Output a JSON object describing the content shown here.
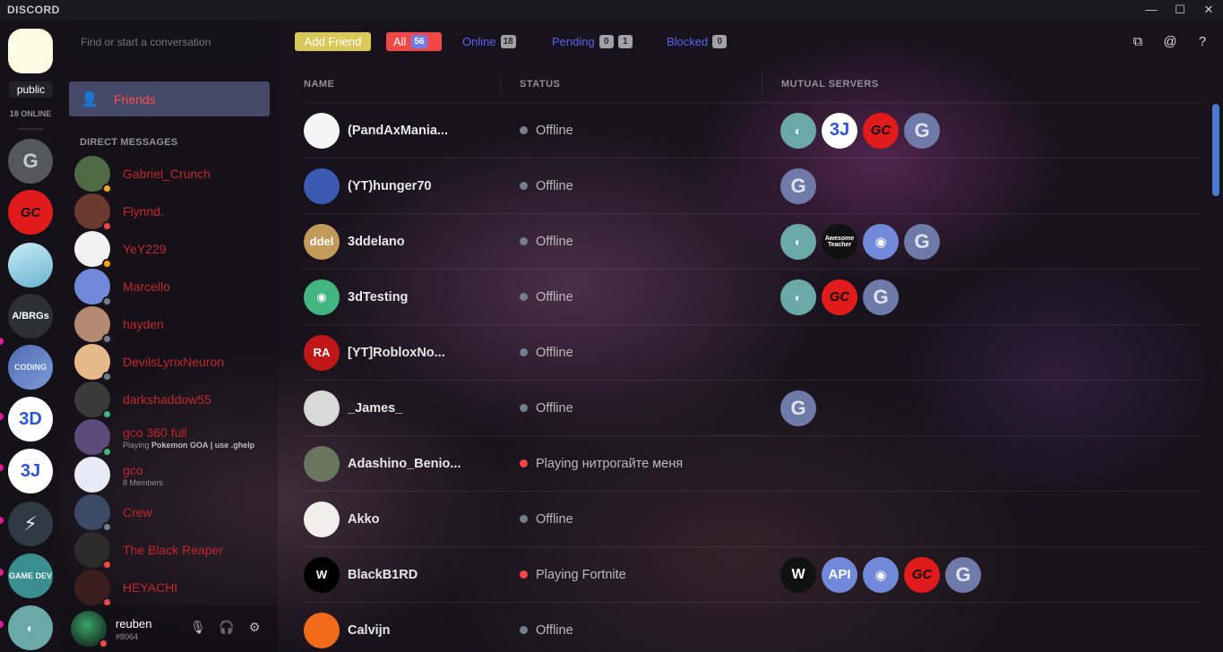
{
  "app": {
    "title": "DISCORD",
    "window_controls": [
      "—",
      "☐",
      "✕"
    ]
  },
  "guilds": {
    "current": {
      "label": "public",
      "color": "#fffbe3"
    },
    "online_count": "18 ONLINE",
    "items": [
      {
        "name": "guild-g",
        "icon": "G",
        "style": "grey"
      },
      {
        "name": "guild-gc-red",
        "icon": "GC",
        "style": "red"
      },
      {
        "name": "guild-ice",
        "icon": "",
        "style": "ice"
      },
      {
        "name": "guild-abrgs",
        "icon": "A/BRGs",
        "style": "dark"
      },
      {
        "name": "guild-coding",
        "icon": "CODING",
        "style": "code"
      },
      {
        "name": "guild-3d",
        "icon": "3D",
        "style": "white"
      },
      {
        "name": "guild-3j",
        "icon": "3J",
        "style": "white"
      },
      {
        "name": "guild-bolt",
        "icon": "⚡",
        "style": "bolt"
      },
      {
        "name": "guild-game-dev",
        "icon": "GAME DEV",
        "style": "game"
      },
      {
        "name": "guild-parrot",
        "icon": "◐",
        "style": "teal"
      }
    ]
  },
  "sidebar": {
    "search_placeholder": "Find or start a conversation",
    "friends_label": "Friends",
    "dm_header": "DIRECT MESSAGES",
    "dms": [
      {
        "name": "Gabriel_Crunch",
        "sub": "",
        "status": "#faa61a",
        "avatar": "#4d6a44"
      },
      {
        "name": "Flynnd.",
        "sub": "",
        "status": "#f04747",
        "avatar": "#6b3a2f"
      },
      {
        "name": "YeY229",
        "sub": "",
        "status": "#faa61a",
        "avatar": "#f1f1f1"
      },
      {
        "name": "Marcello",
        "sub": "",
        "status": "#747f8d",
        "avatar": "#7289da"
      },
      {
        "name": "hayden",
        "sub": "",
        "status": "#747f8d",
        "avatar": "#b48a72"
      },
      {
        "name": "DevilsLynxNeuron",
        "sub": "",
        "status": "#747f8d",
        "avatar": "#e6b98a"
      },
      {
        "name": "darkshaddow55",
        "sub": "",
        "status": "#43b581",
        "avatar": "#3a3a3a"
      },
      {
        "name": "gco 360 full",
        "sub_prefix": "Playing",
        "sub_bold": "Pokemon GOA | use .ghelp",
        "status": "#43b581",
        "avatar": "#5b4a7a"
      },
      {
        "name": "gco",
        "sub": "8 Members",
        "status": "",
        "avatar": "#e8eaf5"
      },
      {
        "name": "Crew",
        "sub": "",
        "status": "#747f8d",
        "avatar": "#3d4a66"
      },
      {
        "name": "The Black Reaper",
        "sub": "",
        "status": "#f04747",
        "avatar": "#2b2b2b"
      },
      {
        "name": "HEYACHI",
        "sub": "",
        "status": "#f04747",
        "avatar": "#3a1e1e"
      }
    ],
    "user": {
      "name": "reuben",
      "discriminator": "#8064"
    },
    "user_controls": [
      "🎙",
      "🎧",
      "⚙"
    ]
  },
  "toolbar": {
    "add_friend": "Add Friend",
    "all_label": "All",
    "all_count": "56",
    "online_label": "Online",
    "online_count": "18",
    "pending_label": "Pending",
    "pending_in": "0",
    "pending_out": "1",
    "blocked_label": "Blocked",
    "blocked_count": "0",
    "icons": [
      "new-group-icon",
      "mention-icon",
      "help-icon"
    ],
    "icon_glyphs": [
      "⧉",
      "@",
      "?"
    ]
  },
  "table": {
    "headers": [
      "NAME",
      "STATUS",
      "MUTUAL SERVERS"
    ],
    "rows": [
      {
        "name": "(PandAxMania...",
        "status": "Offline",
        "dot": "#747f8d",
        "avatar": "#f5f5f5",
        "initial": "",
        "mutual": [
          {
            "icon": "◐",
            "style": "teal"
          },
          {
            "icon": "3J",
            "style": "white"
          },
          {
            "icon": "GC",
            "style": "red"
          },
          {
            "icon": "G",
            "style": "greyc"
          }
        ]
      },
      {
        "name": "(YT)hunger70",
        "status": "Offline",
        "dot": "#747f8d",
        "avatar": "#3b5bb3",
        "initial": "",
        "mutual": [
          {
            "icon": "G",
            "style": "greyc"
          }
        ]
      },
      {
        "name": "3ddelano",
        "status": "Offline",
        "dot": "#747f8d",
        "avatar": "#c49a5b",
        "initial": "ddel",
        "mutual": [
          {
            "icon": "◐",
            "style": "teal"
          },
          {
            "icon": "Awesome Teacher",
            "style": "black"
          },
          {
            "icon": "◉",
            "style": "blurple"
          },
          {
            "icon": "G",
            "style": "greyc"
          }
        ]
      },
      {
        "name": "3dTesting",
        "status": "Offline",
        "dot": "#747f8d",
        "avatar": "#43b581",
        "initial": "◉",
        "mutual": [
          {
            "icon": "◐",
            "style": "teal"
          },
          {
            "icon": "GC",
            "style": "red"
          },
          {
            "icon": "G",
            "style": "greyc"
          }
        ]
      },
      {
        "name": "[YT]RobloxNo...",
        "status": "Offline",
        "dot": "#747f8d",
        "avatar": "#c01818",
        "initial": "RA",
        "mutual": []
      },
      {
        "name": "_James_",
        "status": "Offline",
        "dot": "#747f8d",
        "avatar": "#d8d8d8",
        "initial": "",
        "mutual": [
          {
            "icon": "G",
            "style": "greyc"
          }
        ]
      },
      {
        "name": "Adashino_Benio...",
        "status": "Playing нитрогайте меня",
        "dot": "#f04747",
        "avatar": "#6a7560",
        "initial": "",
        "mutual": []
      },
      {
        "name": "Akko",
        "status": "Offline",
        "dot": "#747f8d",
        "avatar": "#f1eeee",
        "initial": "",
        "mutual": []
      },
      {
        "name": "BlackB1RD",
        "status": "Playing Fortnite",
        "dot": "#f04747",
        "avatar": "#000000",
        "initial": "W",
        "mutual": [
          {
            "icon": "W",
            "style": "black"
          },
          {
            "icon": "API",
            "style": "blurple"
          },
          {
            "icon": "◉",
            "style": "blurple"
          },
          {
            "icon": "GC",
            "style": "red"
          },
          {
            "icon": "G",
            "style": "greyc"
          }
        ]
      },
      {
        "name": "Calvijn",
        "status": "Offline",
        "dot": "#747f8d",
        "avatar": "#f06a1a",
        "initial": "",
        "mutual": []
      }
    ]
  }
}
